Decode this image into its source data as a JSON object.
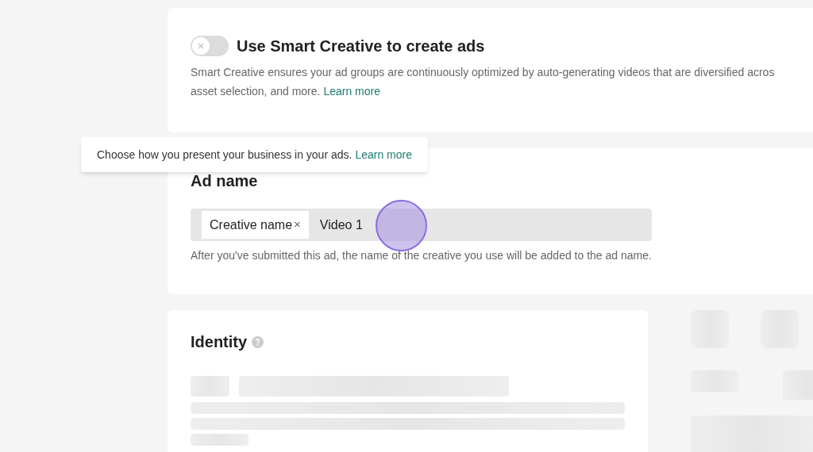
{
  "smart_creative": {
    "toggle": {
      "on": false
    },
    "title": "Use Smart Creative to create ads",
    "description": "Smart Creative ensures your ad groups are continuously optimized by auto-generating videos that are diversified acros",
    "description_2": "asset selection, and more.",
    "link": "Learn more"
  },
  "tooltip": {
    "text": "Choose how you present your business in your ads.",
    "link": "Learn more"
  },
  "ad_name": {
    "title": "Ad name",
    "tag": "Creative name",
    "tag_remove": "×",
    "value": "Video 1",
    "hint": "After you've submitted this ad, the name of the creative you use will be added to the ad name."
  },
  "identity": {
    "title": "Identity"
  }
}
